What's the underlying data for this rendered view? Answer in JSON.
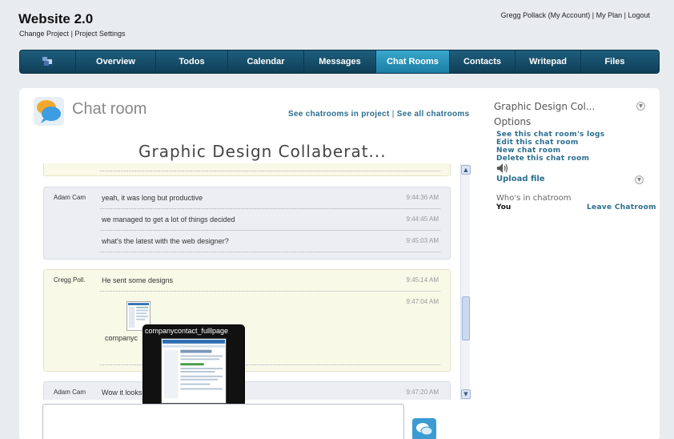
{
  "header": {
    "site_title": "Website 2.0",
    "change_project": "Change Project",
    "project_settings": "Project Settings",
    "user_link": "Gregg Pollack (My Account)",
    "my_plan": "My Plan",
    "logout": "Logout",
    "separator": "|"
  },
  "nav": {
    "items": [
      {
        "label": "Overview"
      },
      {
        "label": "Todos"
      },
      {
        "label": "Calendar"
      },
      {
        "label": "Messages"
      },
      {
        "label": "Chat Rooms",
        "active": true
      },
      {
        "label": "Contacts"
      },
      {
        "label": "Writepad"
      },
      {
        "label": "Files"
      }
    ],
    "home_icon": "home-icon"
  },
  "main": {
    "title": "Chat room",
    "see_project_chatrooms": "See chatrooms in project",
    "see_all_chatrooms": "See all chatrooms",
    "room_name": "Graphic Design Collaberat..."
  },
  "messages": {
    "block1": {
      "author": "Adam Cam",
      "lines": [
        {
          "text": "yeah, it was long but productive",
          "time": "9:44:36 AM"
        },
        {
          "text": "we managed to get a lot of things decided",
          "time": "9:44:45 AM"
        },
        {
          "text": "what's the latest with the web designer?",
          "time": "9:45:03 AM"
        }
      ]
    },
    "block2": {
      "author": "Cregg Poll.",
      "lines": [
        {
          "text": "He sent some designs",
          "time": "9:45:14 AM"
        },
        {
          "text": "",
          "time": "9:47:04 AM"
        }
      ],
      "file_name": "companyc"
    },
    "block3": {
      "author": "Adam Cam",
      "lines": [
        {
          "text": "Wow it looks aw",
          "time": "9:47:20 AM"
        }
      ]
    }
  },
  "tooltip": {
    "title": "companycontact_fulllpage"
  },
  "sidebar": {
    "room_title": "Graphic Design Col...",
    "options_title": "Options",
    "links": [
      "See this chat room's logs",
      "Edit this chat room",
      "New chat room",
      "Delete this chat room"
    ],
    "upload": "Upload file",
    "whos_in": "Who's in chatroom",
    "you": "You",
    "leave": "Leave Chatroom"
  },
  "colors": {
    "nav_bg": "#0f3f57",
    "nav_active": "#2a93bb",
    "link": "#2a6d8d",
    "other_msg_bg": "#eceef3",
    "me_msg_bg": "#f9f9e8"
  }
}
